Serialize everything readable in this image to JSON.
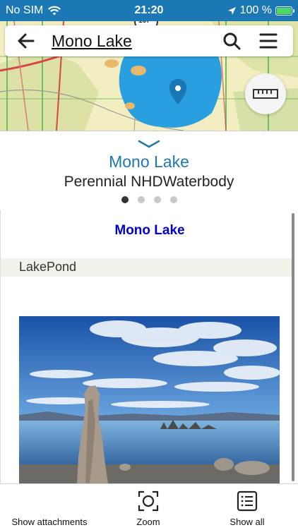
{
  "status_bar": {
    "carrier": "No SIM",
    "time": "21:20",
    "battery": "100 %"
  },
  "search_bar": {
    "title": "Mono Lake"
  },
  "map": {
    "route_shield": "167"
  },
  "popup": {
    "title": "Mono Lake",
    "subtitle": "Perennial NHDWaterbody",
    "page_count": 4,
    "active_page": 1
  },
  "detail": {
    "title": "Mono Lake",
    "type": "LakePond"
  },
  "toolbar": {
    "attachments_label": "Show attachments",
    "zoom_label": "Zoom",
    "show_all_label": "Show all"
  },
  "colors": {
    "accent": "#1b78b5",
    "title_link": "#0000c8",
    "lake": "#2a9fe0",
    "land": "#f3eec1"
  }
}
